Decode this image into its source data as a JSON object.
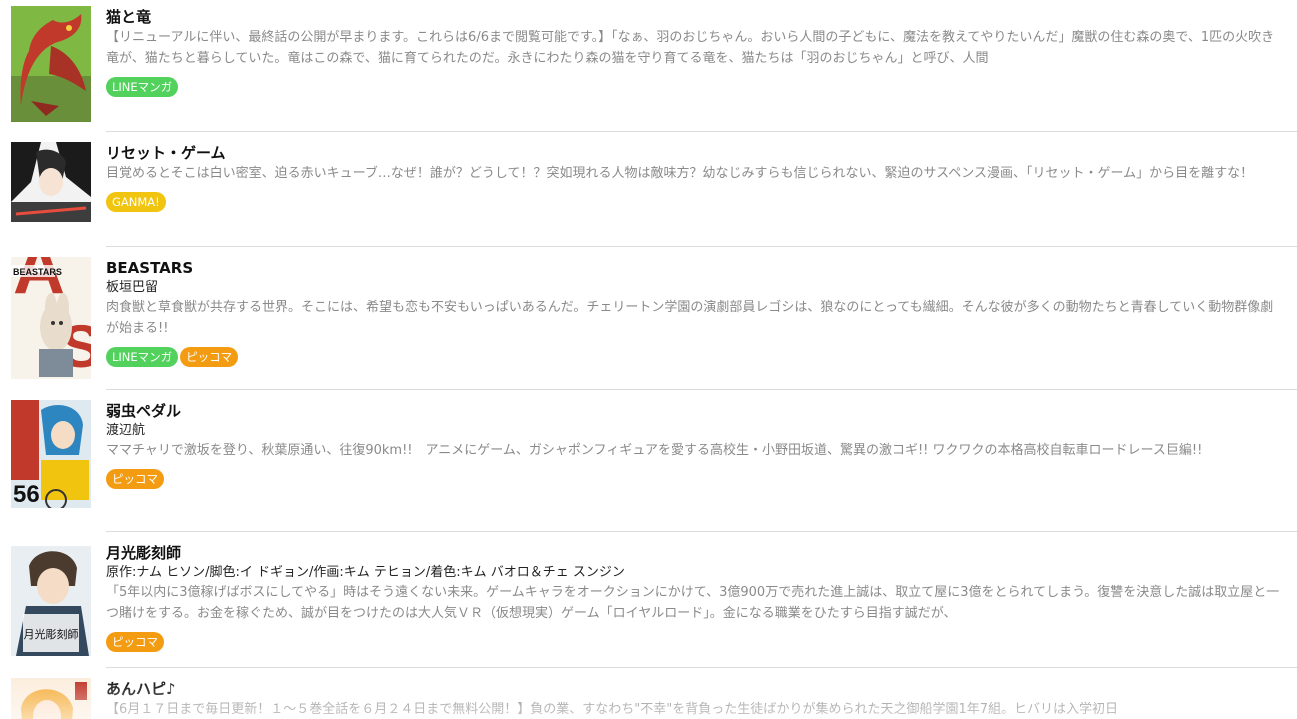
{
  "items": [
    {
      "title": "猫と竜",
      "author": "",
      "description": "【リニューアルに伴い、最終話の公開が早まります。これらは6/6まで閲覧可能です。】「なぁ、羽のおじちゃん。おいら人間の子どもに、魔法を教えてやりたいんだ」魔獣の住む森の奥で、1匹の火吹き竜が、猫たちと暮らしていた。竜はこの森で、猫に育てられたのだ。永きにわたり森の猫を守り育てる竜を、猫たちは「羽のおじちゃん」と呼び、人間",
      "badges": [
        "LINEマンガ"
      ],
      "cover_icon": "dragon-cover"
    },
    {
      "title": "リセット・ゲーム",
      "author": "",
      "description": "目覚めるとそこは白い密室、迫る赤いキューブ…なぜ！誰が？どうして！？突如現れる人物は敵味方？幼なじみすらも信じられない、緊迫のサスペンス漫画、「リセット・ゲーム」から目を離すな！",
      "badges": [
        "GANMA!"
      ],
      "cover_icon": "manga-cover"
    },
    {
      "title": "BEASTARS",
      "author": "板垣巴留",
      "description": "肉食獣と草食獣が共存する世界。そこには、希望も恋も不安もいっぱいあるんだ。チェリートン学園の演劇部員レゴシは、狼なのにとっても繊細。そんな彼が多くの動物たちと青春していく動物群像劇が始まる!!",
      "badges": [
        "LINEマンガ",
        "ピッコマ"
      ],
      "cover_icon": "beastars-cover",
      "cover_text": "BEASTARS"
    },
    {
      "title": "弱虫ペダル",
      "author": "渡辺航",
      "description": "ママチャリで激坂を登り、秋葉原通い、往復90km!!　アニメにゲーム、ガシャポンフィギュアを愛する高校生・小野田坂道、驚異の激コギ!! ワクワクの本格高校自転車ロードレース巨編!!",
      "badges": [
        "ピッコマ"
      ],
      "cover_icon": "cycling-cover",
      "cover_text": "56"
    },
    {
      "title": "月光彫刻師",
      "author": "原作:ナム ヒソン/脚色:イ ドギョン/作画:キム テヒョン/着色:キム バオロ＆チェ スンジン",
      "description": "「5年以内に3億稼げばボスにしてやる」時はそう遠くない未来。ゲームキャラをオークションにかけて、3億900万で売れた進上誠は、取立て屋に3億をとられてしまう。復讐を決意した誠は取立屋と一つ賭けをする。お金を稼ぐため、誠が目をつけたのは大人気ＶＲ（仮想現実）ゲーム「ロイヤルロード」。金になる職業をひたすら目指す誠だが、",
      "badges": [
        "ピッコマ"
      ],
      "cover_icon": "sculptor-cover",
      "cover_text": "月光彫刻師"
    },
    {
      "title": "あんハピ♪",
      "author": "",
      "description": "【6月１７日まで毎日更新！１～５巻全話を６月２４日まで無料公開！】負の業、すなわち\"不幸\"を背負った生徒ばかりが集められた天之御船学園1年7組。ヒバリは入学初日",
      "badges": [],
      "cover_icon": "anhapi-cover"
    }
  ],
  "colors": {
    "line_badge": "#52d15d",
    "ganma_badge": "#f1c40f",
    "piccoma_badge": "#f39c12",
    "description_text": "#8a8a8a",
    "divider": "#dcdcdc"
  }
}
